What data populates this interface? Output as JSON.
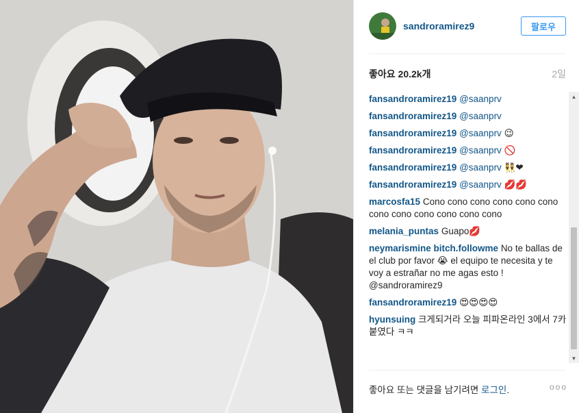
{
  "post": {
    "username": "sandroramirez9",
    "follow_label": "팔로우",
    "likes": "좋아요 20.2k개",
    "time": "2일"
  },
  "comments": [
    {
      "user": "fansandroramirez19",
      "mention": "@saanprv",
      "text": ""
    },
    {
      "user": "fansandroramirez19",
      "mention": "@saanprv",
      "text": ""
    },
    {
      "user": "fansandroramirez19",
      "mention": "@saanprv",
      "text": "😉"
    },
    {
      "user": "fansandroramirez19",
      "mention": "@saanprv",
      "text": "🚫"
    },
    {
      "user": "fansandroramirez19",
      "mention": "@saanprv",
      "text": "👯❤"
    },
    {
      "user": "fansandroramirez19",
      "mention": "@saanprv",
      "text": "💋💋"
    },
    {
      "user": "marcosfa15",
      "mention": "",
      "text": "Cono cono cono cono cono cono cono cono cono cono cono cono"
    },
    {
      "user": "melania_puntas",
      "mention": "",
      "text": "Guapo💋"
    },
    {
      "user": "neymarismine bitch.followme",
      "mention": "",
      "text": "No te ballas de el club por favor 😭 el equipo te necesita y te voy a estrañar no me agas esto ! @sandroramirez9"
    },
    {
      "user": "fansandroramirez19",
      "mention": "",
      "text": "😍😍😍😍"
    },
    {
      "user": "hyunsuing",
      "mention": "",
      "text": "크게되거라 오늘 피파온라인 3에서 7카붙였다 ㅋㅋ"
    }
  ],
  "footer": {
    "prefix": "좋아요 또는 댓글을 남기려면 ",
    "login": "로그인",
    "suffix": ".",
    "more": "ooo"
  }
}
